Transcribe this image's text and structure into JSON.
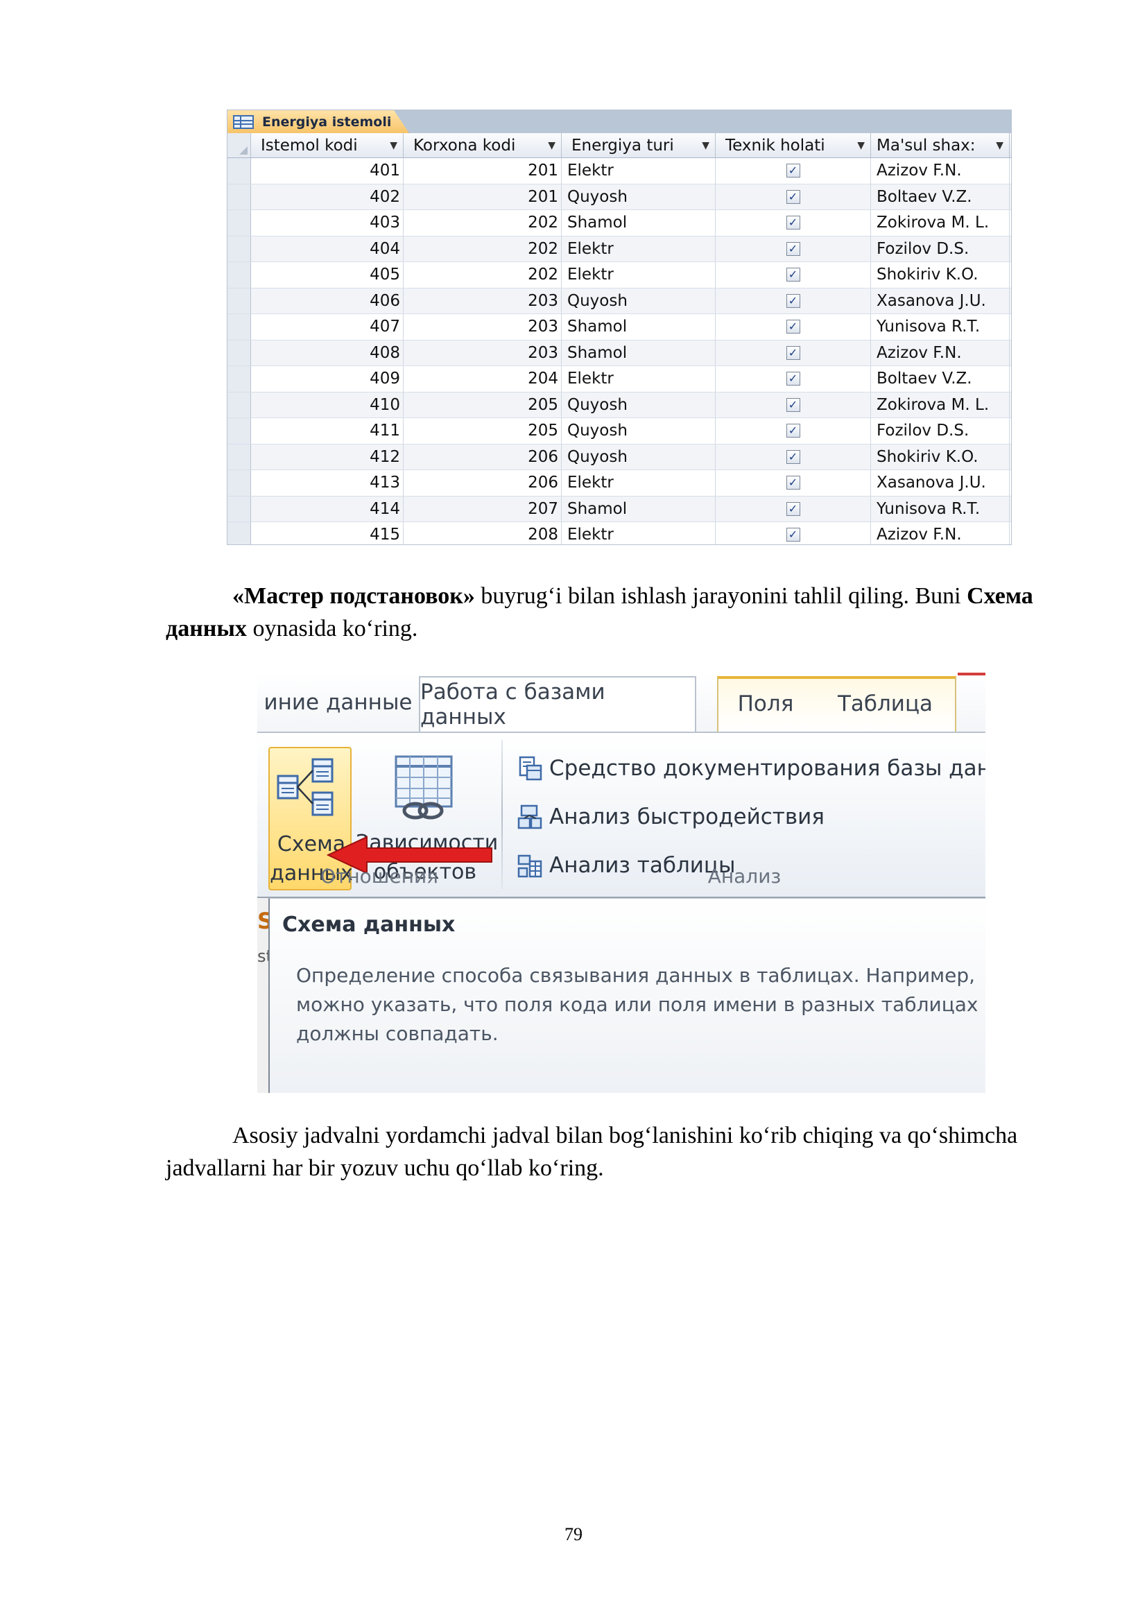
{
  "datasheet": {
    "tab_label": "Energiya istemoli",
    "columns": [
      "Istemol kodi",
      "Korxona kodi",
      "Energiya turi",
      "Texnik holati",
      "Ma'sul shax:"
    ],
    "rows": [
      [
        "401",
        "201",
        "Elektr",
        "✓",
        "Azizov F.N."
      ],
      [
        "402",
        "201",
        "Quyosh",
        "✓",
        "Boltaev V.Z."
      ],
      [
        "403",
        "202",
        "Shamol",
        "✓",
        "Zokirova M. L."
      ],
      [
        "404",
        "202",
        "Elektr",
        "✓",
        "Fozilov D.S."
      ],
      [
        "405",
        "202",
        "Elektr",
        "✓",
        "Shokiriv K.O."
      ],
      [
        "406",
        "203",
        "Quyosh",
        "✓",
        "Xasanova J.U."
      ],
      [
        "407",
        "203",
        "Shamol",
        "✓",
        "Yunisova R.T."
      ],
      [
        "408",
        "203",
        "Shamol",
        "✓",
        "Azizov F.N."
      ],
      [
        "409",
        "204",
        "Elektr",
        "✓",
        "Boltaev V.Z."
      ],
      [
        "410",
        "205",
        "Quyosh",
        "✓",
        "Zokirova M. L."
      ],
      [
        "411",
        "205",
        "Quyosh",
        "✓",
        "Fozilov D.S."
      ],
      [
        "412",
        "206",
        "Quyosh",
        "✓",
        "Shokiriv K.O."
      ],
      [
        "413",
        "206",
        "Elektr",
        "✓",
        "Xasanova J.U."
      ],
      [
        "414",
        "207",
        "Shamol",
        "✓",
        "Yunisova R.T."
      ],
      [
        "415",
        "208",
        "Elektr",
        "✓",
        "Azizov F.N."
      ]
    ]
  },
  "paragraph1": {
    "bold1": "«Мастер подстановок»",
    "text1": " buyrugʻi bilan ishlash jarayonini tahlil qiling. Buni ",
    "bold2": "Схема данных",
    "text2": " oynasida koʻring."
  },
  "ribbon": {
    "tabs": [
      "иние данные",
      "Работа с базами данных",
      "Поля",
      "Таблица"
    ],
    "relations_group": {
      "label": "Отношения",
      "schema_button": [
        "Схема",
        "данных"
      ],
      "dependencies_button": [
        "Зависимости",
        "объектов"
      ]
    },
    "analysis_group": {
      "label": "Анализ",
      "items": [
        "Средство документирования базы данных",
        "Анализ быстродействия",
        "Анализ таблицы"
      ]
    },
    "tooltip": {
      "left_fragment": [
        "S",
        "st"
      ],
      "title": "Схема данных",
      "text": "Определение способа связывания данных в таблицах. Например, можно указать, что поля кода или поля имени в разных таблицах должны совпадать."
    }
  },
  "paragraph2": {
    "text": "Asosiy jadvalni yordamchi jadval bilan bogʻlanishini koʻrib chiqing va qoʻshimcha jadvallarni har bir yozuv uchu qoʻllab koʻring."
  },
  "page_number": "79",
  "colors": {
    "tab_accent": "#f7c46a",
    "arrow": "#e02020",
    "schema_button_bg": "#ffd86b"
  }
}
